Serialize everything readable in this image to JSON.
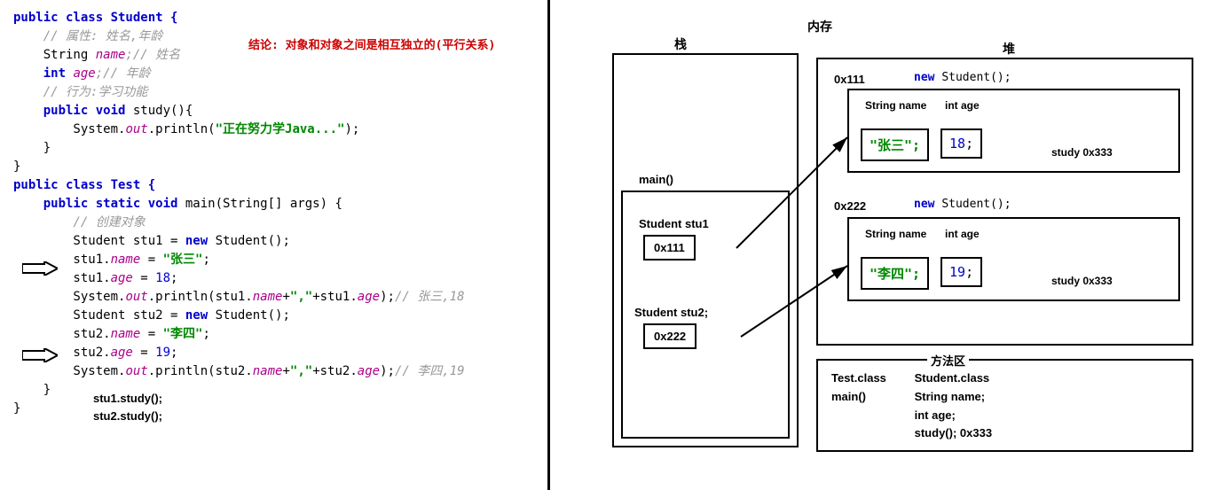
{
  "code": {
    "l1": "public class Student {",
    "l2": "    // 属性: 姓名,年龄",
    "l3a": "    String ",
    "l3b": "name",
    "l3c": ";// 姓名",
    "l4a": "    int ",
    "l4b": "age",
    "l4c": ";// 年龄",
    "l5": "",
    "l6": "    // 行为:学习功能",
    "l7a": "    public void ",
    "l7b": "study(){",
    "l8a": "        System.",
    "l8b": "out",
    "l8c": ".println(",
    "l8d": "\"正在努力学Java...\"",
    "l8e": ");",
    "l9": "    }",
    "l10": "}",
    "l11": "",
    "l12": "public class Test {",
    "l13a": "    public static void ",
    "l13b": "main(String[] args) {",
    "l14": "        // 创建对象",
    "l15a": "        Student stu1 = ",
    "l15b": "new ",
    "l15c": "Student();",
    "l16a": "        stu1.",
    "l16b": "name ",
    "l16c": "= ",
    "l16d": "\"张三\"",
    "l16e": ";",
    "l17a": "        stu1.",
    "l17b": "age ",
    "l17c": "= ",
    "l17d": "18",
    "l17e": ";",
    "l18a": "        System.",
    "l18b": "out",
    "l18c": ".println(stu1.",
    "l18d": "name",
    "l18e": "+",
    "l18f": "\",\"",
    "l18g": "+stu1.",
    "l18h": "age",
    "l18i": ");",
    "l18j": "// 张三,18",
    "l19": "",
    "l20a": "        Student stu2 = ",
    "l20b": "new ",
    "l20c": "Student();",
    "l21a": "        stu2.",
    "l21b": "name ",
    "l21c": "= ",
    "l21d": "\"李四\"",
    "l21e": ";",
    "l22a": "        stu2.",
    "l22b": "age ",
    "l22c": "= ",
    "l22d": "19",
    "l22e": ";",
    "l23a": "        System.",
    "l23b": "out",
    "l23c": ".println(stu2.",
    "l23d": "name",
    "l23e": "+",
    "l23f": "\",\"",
    "l23g": "+stu2.",
    "l23h": "age",
    "l23i": ");",
    "l23j": "// 李四,19",
    "l24": "    }",
    "l25": "}",
    "study1": "stu1.study();",
    "study2": "stu2.study();"
  },
  "conclusion": "结论: 对象和对象之间是相互独立的(平行关系)",
  "memory": {
    "title": "内存",
    "stack": "栈",
    "heap": "堆",
    "methodArea": "方法区",
    "main": "main()",
    "stu1Label": "Student stu1",
    "stu1Val": "0x111",
    "stu2Label": "Student stu2;",
    "stu2Val": "0x222",
    "obj1Addr": "0x111",
    "obj2Addr": "0x222",
    "newStudent": "new Student();",
    "newKw": "new ",
    "stringName": "String name",
    "intAge": "int age",
    "intAge2": "int  age",
    "name1": "\"张三\";",
    "age1": "18;",
    "name2": "\"李四\";",
    "age2": "19;",
    "studyRef": "study 0x333",
    "testClass": "Test.class",
    "studentClass": "Student.class",
    "mainMethod": "main()",
    "fieldName": "String name;",
    "fieldAge": "int age;",
    "studyMethod": "study(); 0x333"
  }
}
